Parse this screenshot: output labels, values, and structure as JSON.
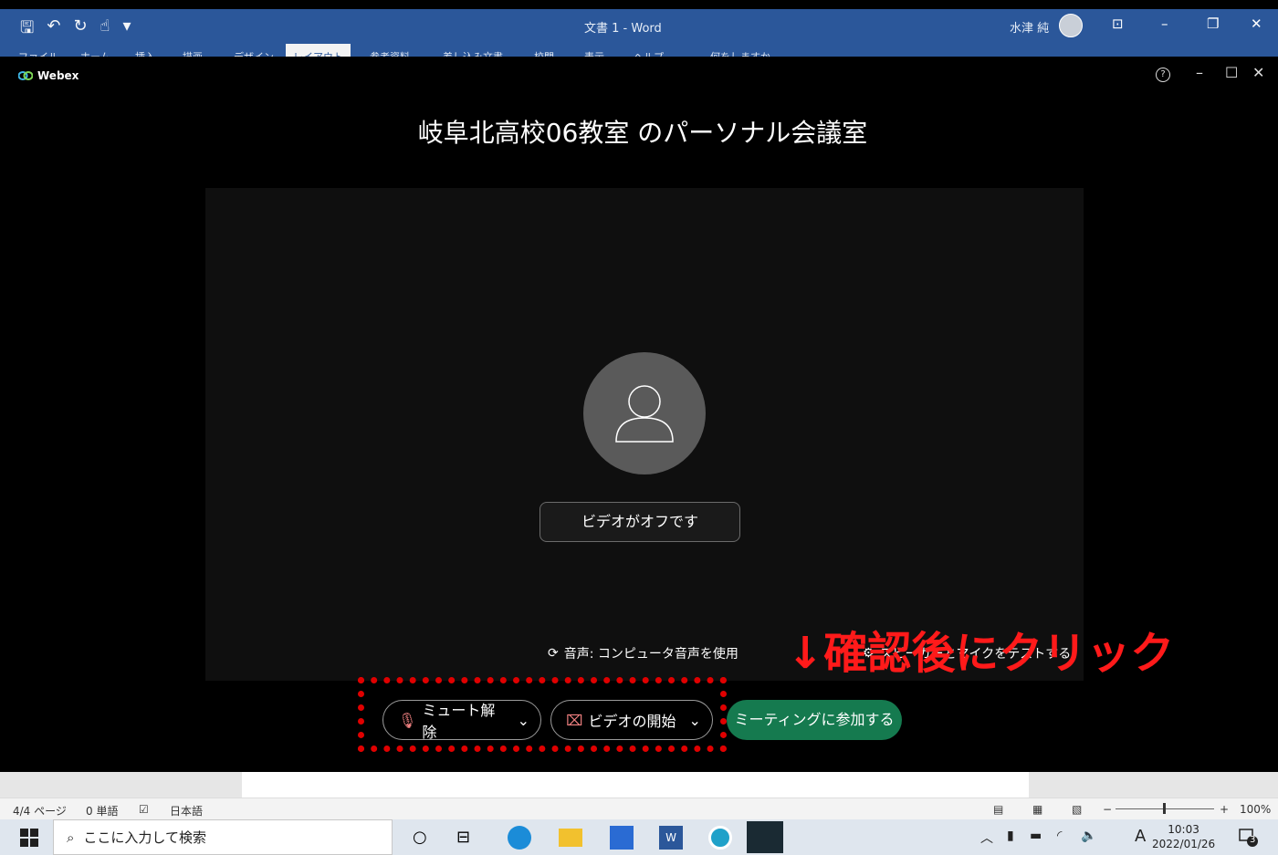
{
  "word": {
    "title": "文書 1  -  Word",
    "user": "水津 純",
    "ribbon_tabs": [
      "ファイル",
      "ホーム",
      "挿入",
      "描画",
      "デザイン",
      "レイアウト",
      "参考資料",
      "差し込み文書",
      "校閲",
      "表示",
      "ヘルプ",
      "何をしますか"
    ],
    "active_tab": "レイアウト",
    "status": {
      "page": "4/4 ページ",
      "words": "0 単語",
      "language": "日本語",
      "zoom": "100%",
      "zoom_minus": "−",
      "zoom_plus": "+"
    }
  },
  "webex": {
    "app_name": "Webex",
    "help": "?",
    "meeting_title": "岐阜北高校06教室 のパーソナル会議室",
    "video_off": "ビデオがオフです",
    "audio_status": "音声: コンピュータ音声を使用",
    "test_link": "スピーカーとマイクをテストする",
    "mute_button": "ミュート解除",
    "video_button": "ビデオの開始",
    "join_button": "ミーティングに参加する",
    "colors": {
      "join": "#157a4f",
      "background": "#000000"
    }
  },
  "annotation": {
    "text": "↓確認後にクリック",
    "color": "#ff1a1a"
  },
  "taskbar": {
    "search_placeholder": "ここに入力して検索",
    "time": "10:03",
    "date": "2022/01/26",
    "ime": "A",
    "notification_count": "3"
  }
}
